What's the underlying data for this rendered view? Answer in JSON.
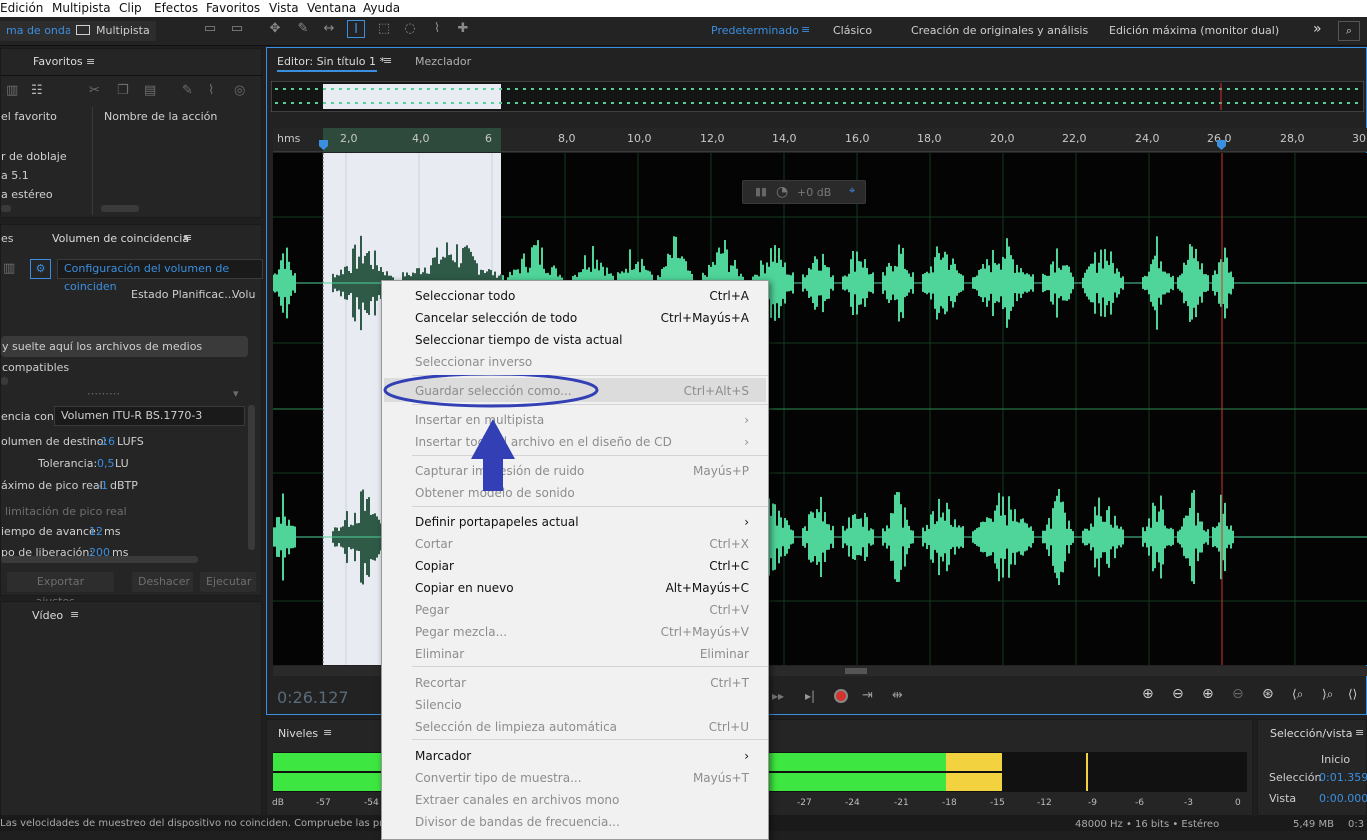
{
  "menu": [
    "Edición",
    "Multipista",
    "Clip",
    "Efectos",
    "Favoritos",
    "Vista",
    "Ventana",
    "Ayuda"
  ],
  "toolbar": {
    "waveform_label": "ma de onda",
    "multitrack_label": "Multipista",
    "workspaces": [
      "Predeterminado",
      "Clásico",
      "Creación de originales y análisis",
      "Edición máxima (monitor dual)"
    ],
    "overflow": "»"
  },
  "favorites": {
    "title": "Favoritos",
    "col1": "el favorito",
    "col2": "Nombre de la acción",
    "items": [
      "r de doblaje",
      "a 5.1",
      "a estéreo"
    ]
  },
  "loudness": {
    "tab_left": "es",
    "title": "Volumen de coincidencia",
    "preset": "Configuración del volumen de coinciden",
    "cols": [
      "Estado",
      "Planificac...",
      "Volu"
    ],
    "drop_hint": "y suelte aquí los archivos de medios compatibles",
    "match_to_label": "encia con:",
    "match_to_value": "Volumen ITU-R BS.1770-3",
    "target_label": "olumen de destino:",
    "target_value": "-16",
    "target_unit": "LUFS",
    "tolerance_label": "Tolerancia:",
    "tolerance_value": "0,5",
    "tolerance_unit": "LU",
    "peak_label": "áximo de pico real:",
    "peak_value": "-1",
    "peak_unit": "dBTP",
    "limit_label": "limitación de pico real",
    "lookahead_label": "iempo de avance:",
    "lookahead_value": "12",
    "lookahead_unit": "ms",
    "release_label": "po de liberación:",
    "release_value": "200",
    "release_unit": "ms",
    "export_btn": "Exportar ajustes...",
    "undo_btn": "Deshacer",
    "run_btn": "Ejecutar"
  },
  "video": {
    "title": "Vídeo"
  },
  "editor": {
    "tab_title": "Editor: Sin título 1 *",
    "mixer_tab": "Mezclador",
    "time_unit": "hms",
    "ticks": [
      "2,0",
      "4,0",
      "6",
      "8,0",
      "10,0",
      "12,0",
      "14,0",
      "16,0",
      "18,0",
      "20,0",
      "22,0",
      "24,0",
      "26,0",
      "28,0",
      "30"
    ],
    "hud_gain": "+0 dB",
    "current_time": "0:26.127"
  },
  "context_menu": {
    "items": [
      {
        "label": "Seleccionar todo",
        "shortcut": "Ctrl+A",
        "enabled": true
      },
      {
        "label": "Cancelar selección de todo",
        "shortcut": "Ctrl+Mayús+A",
        "enabled": true
      },
      {
        "label": "Seleccionar tiempo de vista actual",
        "shortcut": "",
        "enabled": true
      },
      {
        "label": "Seleccionar inverso",
        "shortcut": "",
        "enabled": false
      },
      {
        "label": "Guardar selección como...",
        "shortcut": "Ctrl+Alt+S",
        "enabled": false
      },
      {
        "label": "Insertar en multipista",
        "shortcut": "›",
        "enabled": false
      },
      {
        "label": "Insertar todo el archivo en el diseño de CD",
        "shortcut": "›",
        "enabled": false
      },
      {
        "label": "Capturar impresión de ruido",
        "shortcut": "Mayús+P",
        "enabled": false
      },
      {
        "label": "Obtener modelo de sonido",
        "shortcut": "",
        "enabled": false
      },
      {
        "label": "Definir portapapeles actual",
        "shortcut": "›",
        "enabled": true
      },
      {
        "label": "Cortar",
        "shortcut": "Ctrl+X",
        "enabled": false
      },
      {
        "label": "Copiar",
        "shortcut": "Ctrl+C",
        "enabled": true
      },
      {
        "label": "Copiar en nuevo",
        "shortcut": "Alt+Mayús+C",
        "enabled": true
      },
      {
        "label": "Pegar",
        "shortcut": "Ctrl+V",
        "enabled": false
      },
      {
        "label": "Pegar mezcla...",
        "shortcut": "Ctrl+Mayús+V",
        "enabled": false
      },
      {
        "label": "Eliminar",
        "shortcut": "Eliminar",
        "enabled": false
      },
      {
        "label": "Recortar",
        "shortcut": "Ctrl+T",
        "enabled": false
      },
      {
        "label": "Silencio",
        "shortcut": "",
        "enabled": false
      },
      {
        "label": "Selección de limpieza automática",
        "shortcut": "Ctrl+U",
        "enabled": false
      },
      {
        "label": "Marcador",
        "shortcut": "›",
        "enabled": true
      },
      {
        "label": "Convertir tipo de muestra...",
        "shortcut": "Mayús+T",
        "enabled": false
      },
      {
        "label": "Extraer canales en archivos mono",
        "shortcut": "",
        "enabled": false
      },
      {
        "label": "Divisor de bandas de frecuencia...",
        "shortcut": "",
        "enabled": false
      }
    ]
  },
  "levels": {
    "title": "Niveles",
    "scale": [
      "dB",
      "-57",
      "-54",
      "-27",
      "-24",
      "-21",
      "-18",
      "-15",
      "-12",
      "-9",
      "-6",
      "-3",
      "0"
    ]
  },
  "selection_view": {
    "title": "Selección/vista",
    "col_start": "Inicio",
    "selection_label": "Selección",
    "selection_value": "0:01.359",
    "view_label": "Vista",
    "view_value": "0:00.000"
  },
  "status": {
    "message": "Las velocidades de muestreo del dispositivo no coinciden. Compruebe las pref",
    "format": "48000 Hz • 16 bits • Estéreo",
    "size": "5,49 MB",
    "duration": "0:3"
  },
  "colors": {
    "accent": "#3b8fe0",
    "waveform": "#4fd49a",
    "playhead": "#d0342c",
    "annotation": "#3340b5",
    "meter_green": "#3de640",
    "meter_yellow": "#f2d23e"
  }
}
